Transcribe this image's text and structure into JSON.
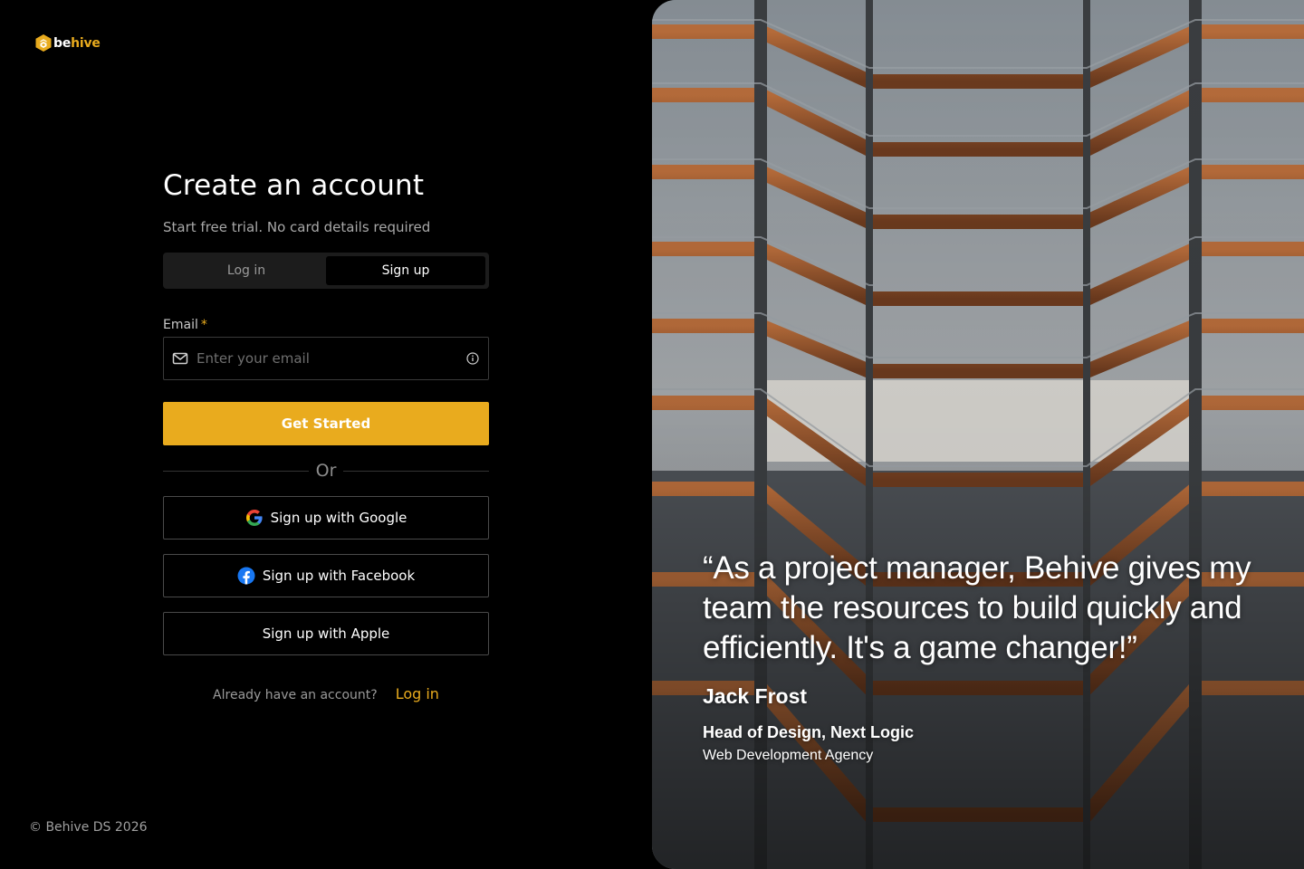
{
  "brand": {
    "name_part1": "be",
    "name_part2": "hive",
    "accent_color": "#E9AB1E"
  },
  "form": {
    "title": "Create an account",
    "subtitle": "Start free trial. No card details required",
    "tabs": [
      {
        "label": "Log in",
        "selected": false
      },
      {
        "label": "Sign up",
        "selected": true
      }
    ],
    "email": {
      "label": "Email",
      "required_mark": "*",
      "placeholder": "Enter your email",
      "value": ""
    },
    "primary_button": "Get Started",
    "divider": "Or",
    "social_buttons": [
      {
        "label": "Sign up with Google",
        "icon": "google-icon"
      },
      {
        "label": "Sign up with Facebook",
        "icon": "facebook-icon"
      },
      {
        "label": "Sign up with Apple",
        "icon": "none"
      }
    ],
    "have_account_text": "Already have an account?",
    "login_link": "Log in"
  },
  "footer": {
    "copyright": "© Behive DS 2026"
  },
  "testimonial": {
    "quote": "“As a project manager, Behive gives my team the resources to build quickly and efficiently. It's a game changer!”",
    "author": "Jack Frost",
    "role": "Head of Design, Next Logic",
    "company": "Web Development Agency"
  }
}
